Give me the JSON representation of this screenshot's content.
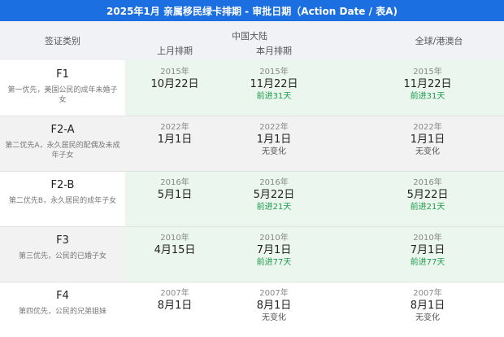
{
  "title": "2025年1月 亲属移民绿卡排期 - 审批日期（Action Date / 表A)",
  "header": {
    "category": "签证类别",
    "group": "中国大陆",
    "prev": "上月排期",
    "curr": "本月排期",
    "global": "全球/港澳台"
  },
  "rows": [
    {
      "code": "F1",
      "desc": "第一优先，美国公民的成年未婚子女",
      "prev": {
        "year": "2015年",
        "md": "10月22日"
      },
      "curr": {
        "year": "2015年",
        "md": "11月22日",
        "change": "前进31天"
      },
      "global": {
        "year": "2015年",
        "md": "11月22日",
        "change": "前进31天"
      }
    },
    {
      "code": "F2-A",
      "desc": "第二优先A，永久居民的配偶及未成年子女",
      "prev": {
        "year": "2022年",
        "md": "1月1日"
      },
      "curr": {
        "year": "2022年",
        "md": "1月1日",
        "change": "无变化"
      },
      "global": {
        "year": "2022年",
        "md": "1月1日",
        "change": "无变化"
      }
    },
    {
      "code": "F2-B",
      "desc": "第二优先B，永久居民的成年子女",
      "prev": {
        "year": "2016年",
        "md": "5月1日"
      },
      "curr": {
        "year": "2016年",
        "md": "5月22日",
        "change": "前进21天"
      },
      "global": {
        "year": "2016年",
        "md": "5月22日",
        "change": "前进21天"
      }
    },
    {
      "code": "F3",
      "desc": "第三优先，公民的已婚子女",
      "prev": {
        "year": "2010年",
        "md": "4月15日"
      },
      "curr": {
        "year": "2010年",
        "md": "7月1日",
        "change": "前进77天"
      },
      "global": {
        "year": "2010年",
        "md": "7月1日",
        "change": "前进77天"
      }
    },
    {
      "code": "F4",
      "desc": "第四优先，公民的兄弟姐妹",
      "prev": {
        "year": "2007年",
        "md": "8月1日"
      },
      "curr": {
        "year": "2007年",
        "md": "8月1日",
        "change": "无变化"
      },
      "global": {
        "year": "2007年",
        "md": "8月1日",
        "change": "无变化"
      }
    }
  ],
  "colors": {
    "title_bg": "#1b6fe0",
    "advance": "#1e9a4a",
    "highlight_bg": "#eaf6ee",
    "alt_bg": "#f2f2f2"
  }
}
